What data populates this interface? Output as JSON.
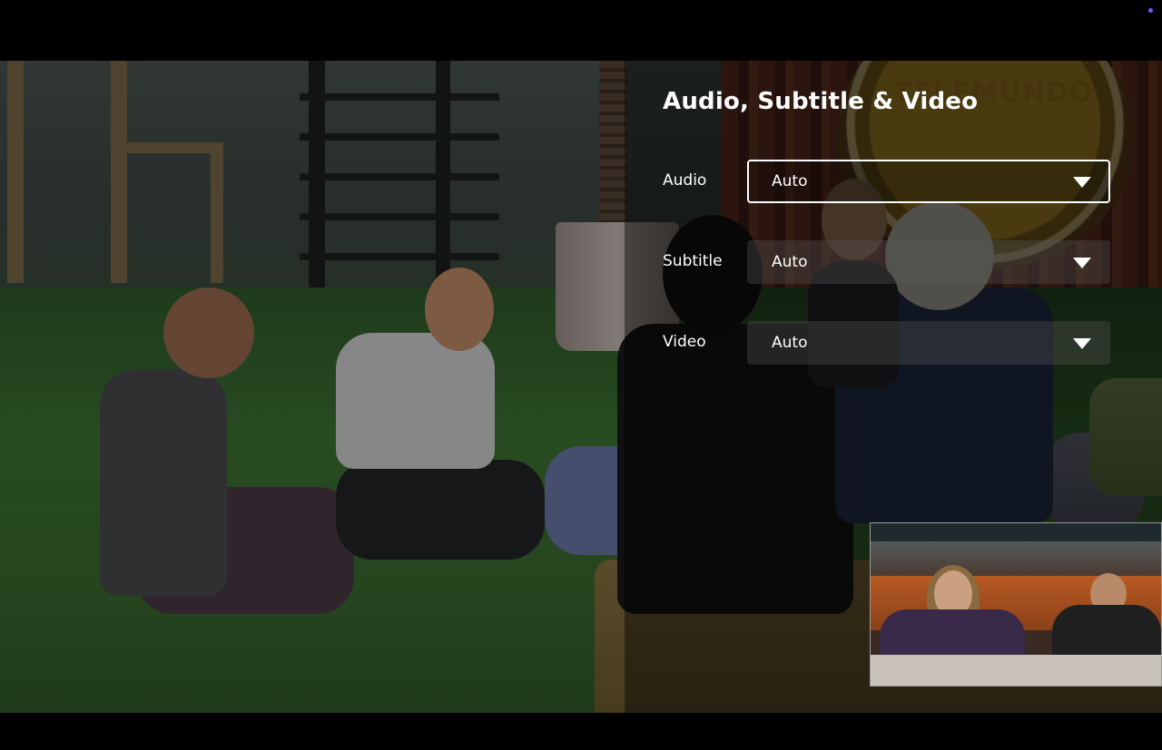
{
  "panel": {
    "title": "Audio, Subtitle & Video",
    "settings": [
      {
        "label": "Audio",
        "value": "Auto",
        "focused": true
      },
      {
        "label": "Subtitle",
        "value": "Auto",
        "focused": false
      },
      {
        "label": "Video",
        "value": "Auto",
        "focused": false
      }
    ]
  },
  "background": {
    "sign_text": "TELEMUNDO"
  },
  "icons": {
    "dropdown": "chevron-down-icon",
    "status": "status-dot"
  },
  "colors": {
    "focus_border": "#ffffff",
    "panel_bg": "rgba(0,0,0,0.42)",
    "status_dot": "#6a5cff"
  }
}
